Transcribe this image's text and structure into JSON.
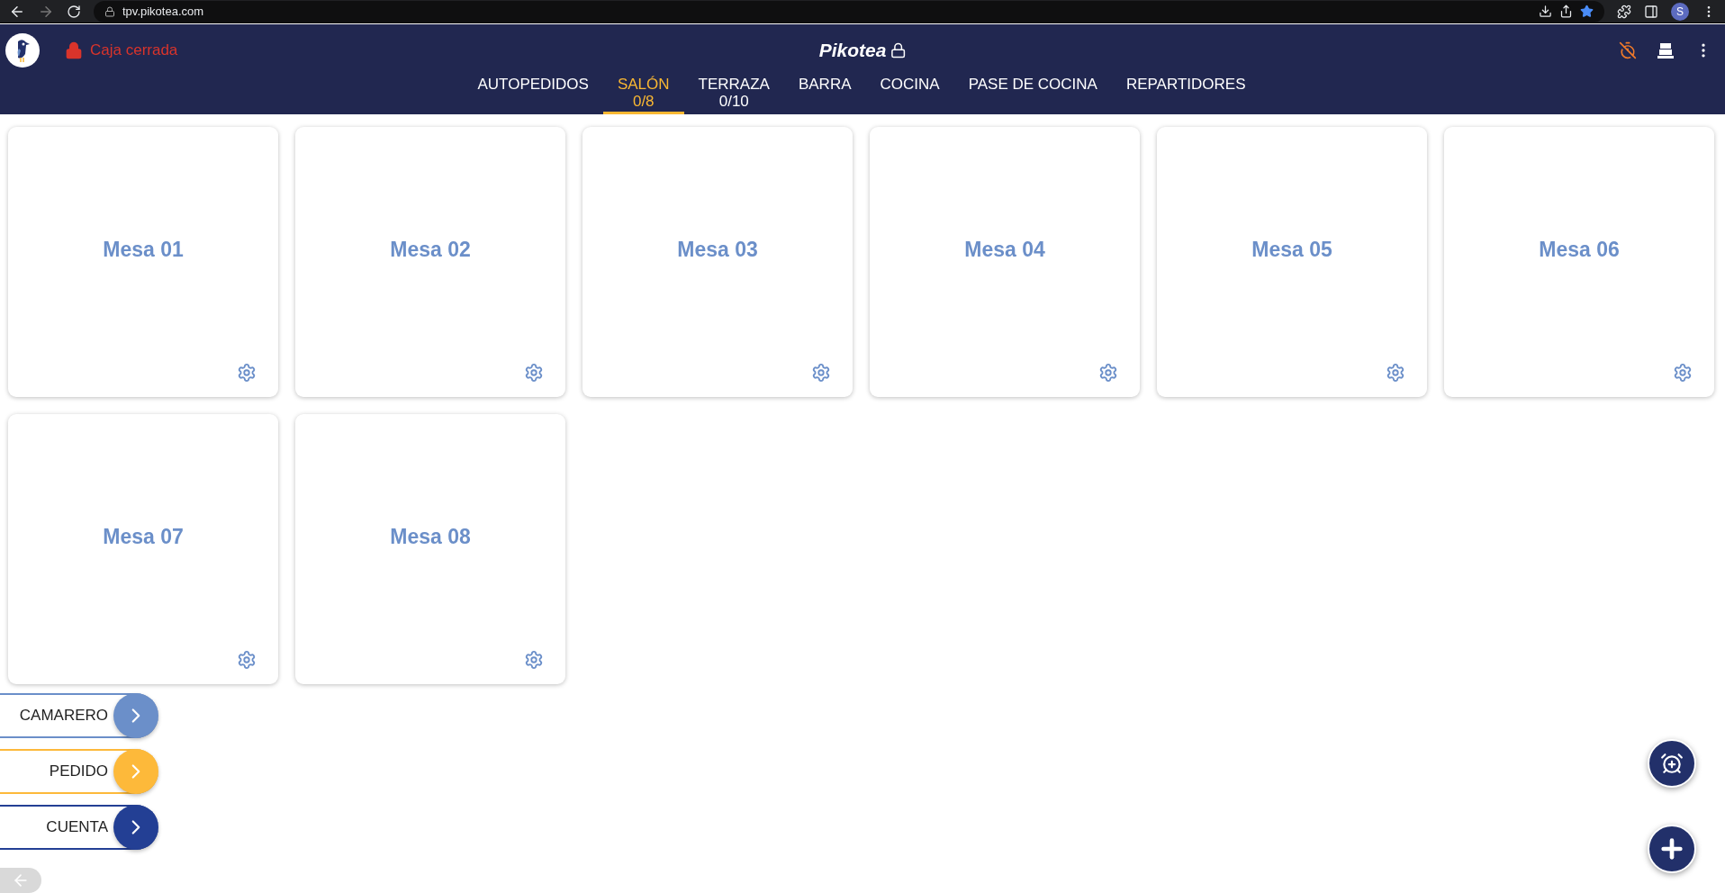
{
  "browser": {
    "url": "tpv.pikotea.com",
    "profile_initial": "S"
  },
  "header": {
    "cash_status": "Caja cerrada",
    "brand": "Pikotea"
  },
  "tabs": [
    {
      "label": "AUTOPEDIDOS",
      "selected": false
    },
    {
      "label": "SALÓN",
      "count": "0/8",
      "selected": true
    },
    {
      "label": "TERRAZA",
      "count": "0/10",
      "selected": false
    },
    {
      "label": "BARRA",
      "selected": false
    },
    {
      "label": "COCINA",
      "selected": false
    },
    {
      "label": "PASE DE COCINA",
      "selected": false
    },
    {
      "label": "REPARTIDORES",
      "selected": false
    }
  ],
  "tables": [
    {
      "name": "Mesa 01"
    },
    {
      "name": "Mesa 02"
    },
    {
      "name": "Mesa 03"
    },
    {
      "name": "Mesa 04"
    },
    {
      "name": "Mesa 05"
    },
    {
      "name": "Mesa 06"
    },
    {
      "name": "Mesa 07"
    },
    {
      "name": "Mesa 08"
    }
  ],
  "side_actions": [
    {
      "label": "CAMARERO",
      "color": "#6b8fc9"
    },
    {
      "label": "PEDIDO",
      "color": "#fdb93a"
    },
    {
      "label": "CUENTA",
      "color": "#233f94"
    }
  ]
}
